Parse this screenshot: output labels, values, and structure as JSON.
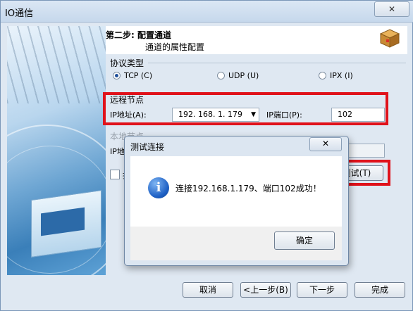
{
  "window": {
    "title": "IO通信",
    "close": "✕"
  },
  "header": {
    "step": "第二步: 配置通道",
    "subtitle": "通道的属性配置"
  },
  "protocol": {
    "group_label": "协议类型",
    "options": [
      {
        "label": "TCP (C)",
        "selected": true
      },
      {
        "label": "UDP (U)",
        "selected": false
      },
      {
        "label": "IPX (I)",
        "selected": false
      }
    ]
  },
  "remote": {
    "group_label": "远程节点",
    "ip_label": "IP地址(A):",
    "ip_value": "192. 168. 1. 179",
    "port_label": "IP端口(P):",
    "port_value": "102"
  },
  "local": {
    "group_label": "本地节点",
    "ip_label": "IP地"
  },
  "checkbox": {
    "label": "指"
  },
  "test_button": {
    "label": "测试(T)"
  },
  "dialog": {
    "title": "测试连接",
    "close": "✕",
    "icon": "info-icon",
    "message": "连接192.168.1.179、端口102成功！",
    "ok": "确定"
  },
  "footer": {
    "cancel": "取消",
    "back": "<上一步(B)",
    "next": "下一步",
    "finish": "完成"
  },
  "colors": {
    "highlight": "#e0121b",
    "accent": "#1d5fc4"
  }
}
